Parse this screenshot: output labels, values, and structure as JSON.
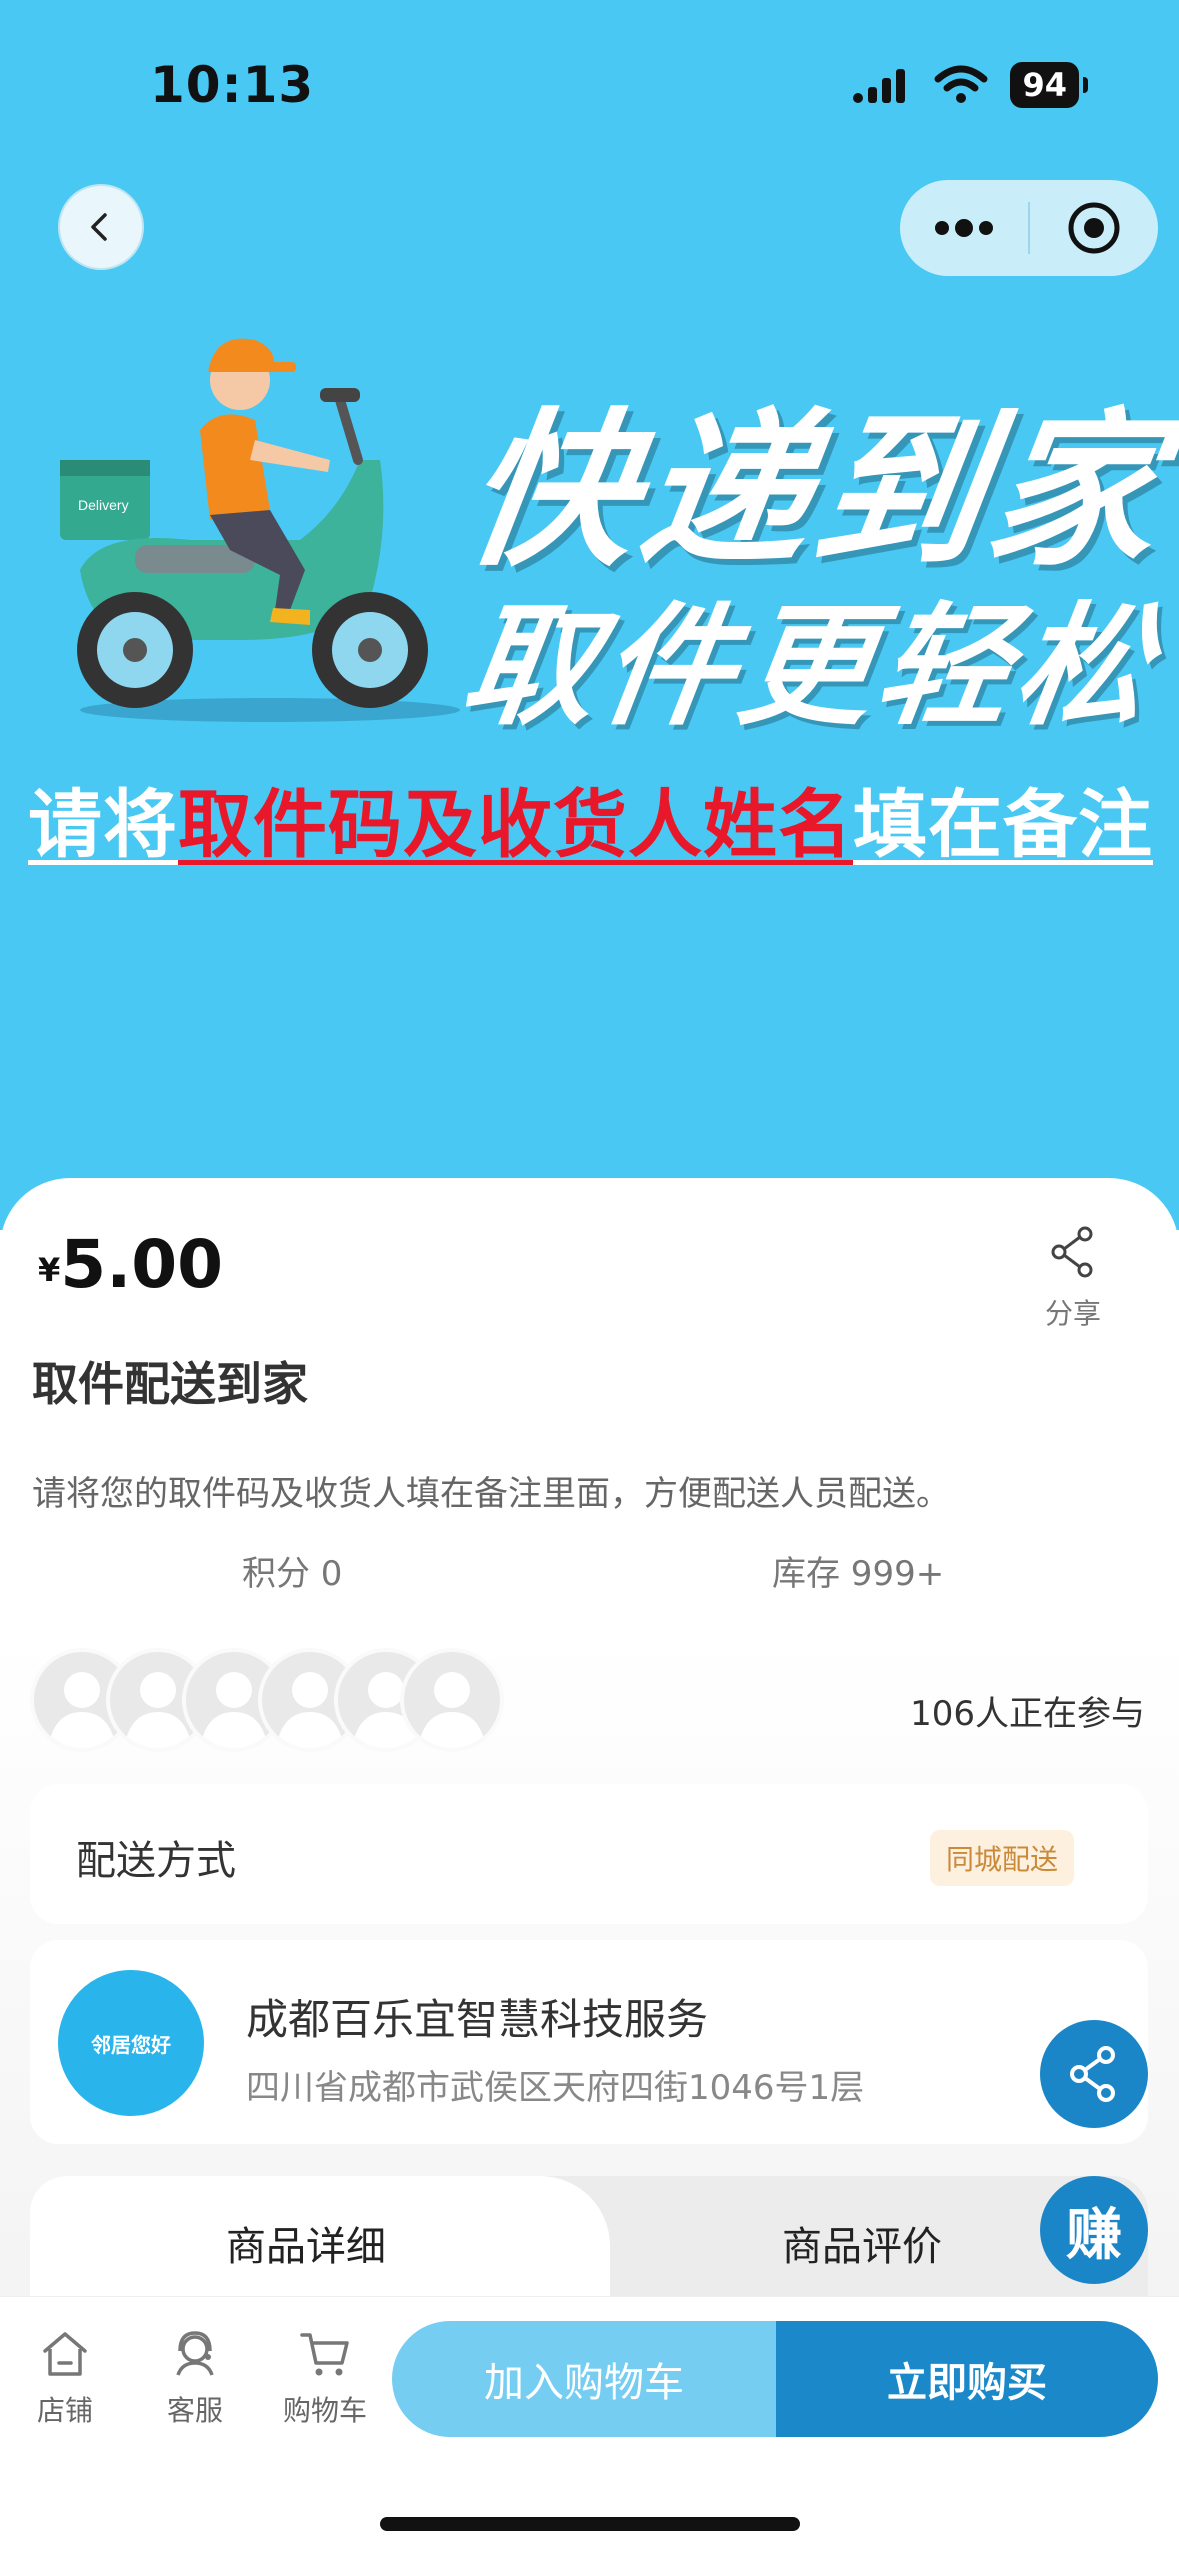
{
  "status_bar": {
    "time": "10:13",
    "battery": "94"
  },
  "banner": {
    "title": "快递到家",
    "subtitle": "取件更轻松",
    "note_prefix": "请将",
    "note_highlight": "取件码及收货人姓名",
    "note_suffix": "填在备注",
    "scooter_box_text": "Delivery"
  },
  "product": {
    "currency": "¥",
    "price": "5.00",
    "share_label": "分享",
    "title": "取件配送到家",
    "description": "请将您的取件码及收货人填在备注里面，方便配送人员配送。",
    "points": "积分 0",
    "stock": "库存 999+",
    "participants": "106人正在参与"
  },
  "delivery": {
    "label": "配送方式",
    "tag": "同城配送"
  },
  "store": {
    "logo_text": "邻居您好",
    "name": "成都百乐宜智慧科技服务",
    "address": "四川省成都市武侯区天府四街1046号1层"
  },
  "tabs": [
    {
      "label": "商品详细"
    },
    {
      "label": "商品评价"
    }
  ],
  "fab": {
    "earn_label": "赚"
  },
  "bottom_nav": [
    {
      "label": "店铺"
    },
    {
      "label": "客服"
    },
    {
      "label": "购物车"
    }
  ],
  "actions": {
    "add_to_cart": "加入购物车",
    "buy_now": "立即购买"
  },
  "colors": {
    "banner_bg": "#49c8f4",
    "accent": "#1a88c9",
    "cart_btn": "#75cdf2",
    "highlight_red": "#e8172a"
  }
}
